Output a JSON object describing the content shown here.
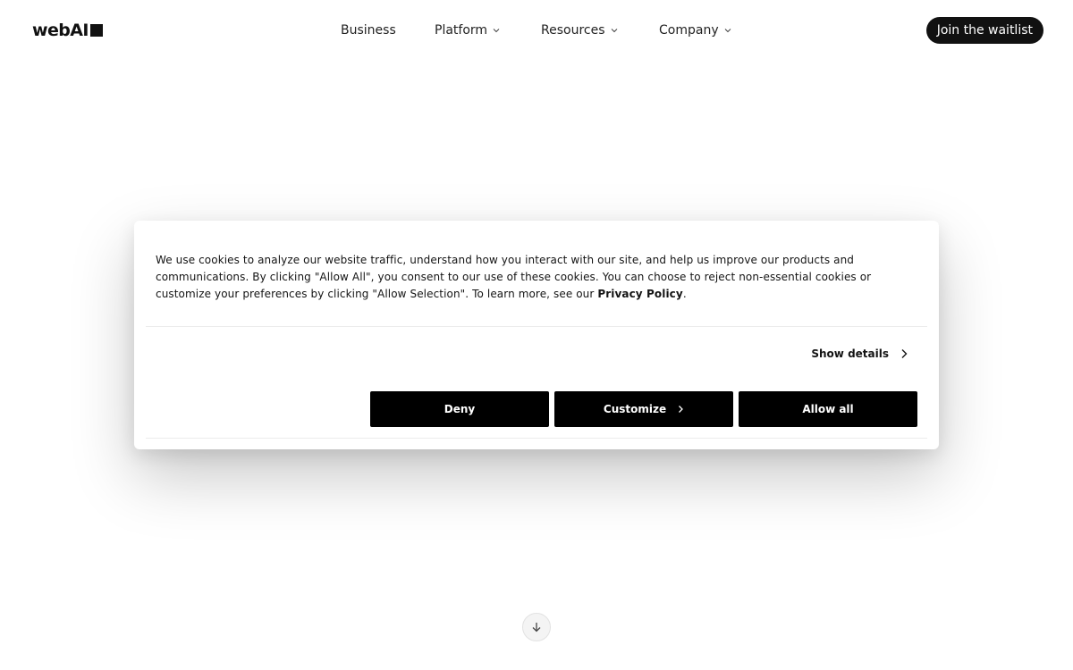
{
  "header": {
    "logo_text": "webAI",
    "nav": [
      {
        "label": "Business",
        "has_dropdown": false
      },
      {
        "label": "Platform",
        "has_dropdown": true
      },
      {
        "label": "Resources",
        "has_dropdown": true
      },
      {
        "label": "Company",
        "has_dropdown": true
      }
    ],
    "cta_label": "Join the waitlist"
  },
  "cookie_banner": {
    "text_part1": "We use cookies to analyze our website traffic, understand how you interact with our site, and help us improve our products and communications. By clicking \"Allow All\", you consent to our use of these cookies. You can choose to reject non-essential cookies or customize your preferences by clicking \"Allow Selection\". To learn more, see our ",
    "privacy_link": "Privacy Policy",
    "text_end": ".",
    "show_details_label": "Show details",
    "buttons": {
      "deny": "Deny",
      "customize": "Customize",
      "allow_all": "Allow all"
    }
  },
  "icons": {
    "nav_dropdown": "chevron-down-icon",
    "show_details": "chevron-right-icon",
    "customize": "chevron-right-icon",
    "scroll": "arrow-down-icon"
  },
  "colors": {
    "primary_dark": "#111111",
    "button_black": "#000000",
    "background": "#ffffff"
  }
}
